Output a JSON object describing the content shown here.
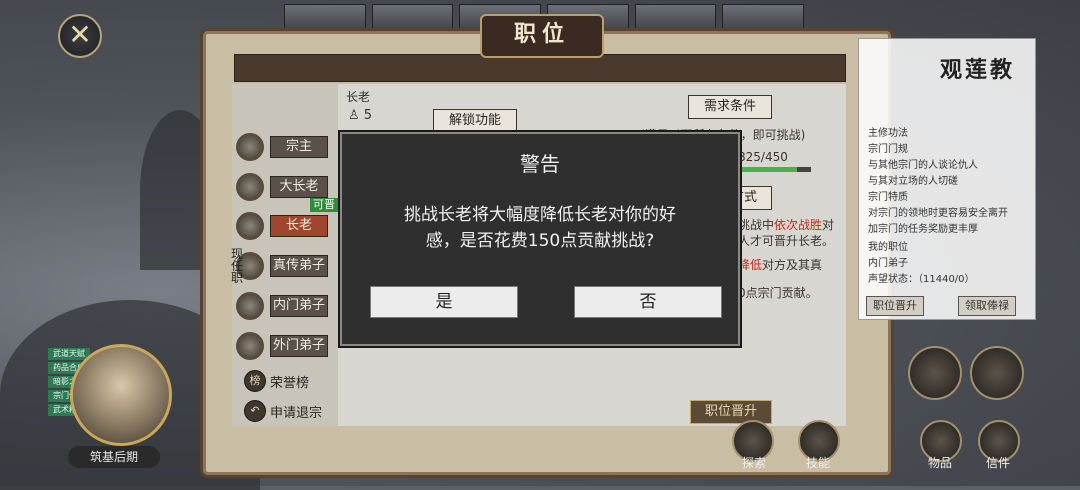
{
  "frame_title": "职位",
  "left_ranks": [
    {
      "label": "宗主",
      "active": false
    },
    {
      "label": "大长老",
      "active": false
    },
    {
      "label": "长老",
      "active": true
    },
    {
      "label": "真传弟子",
      "active": false
    },
    {
      "label": "内门弟子",
      "active": false
    },
    {
      "label": "外门弟子",
      "active": false
    }
  ],
  "current_position_tag": "现任职",
  "promotable_tag": "可晋",
  "side_buttons": [
    {
      "icon": "榜",
      "label": "荣誉榜"
    },
    {
      "icon": "↶",
      "label": "申请退宗"
    }
  ],
  "rank_header": "长老",
  "rank_count": "5",
  "unlock_button": "解锁功能",
  "requirements_button": "需求条件",
  "requirements_note": "(满足以下所有条件，即可挑战)",
  "progress_text": "825/450",
  "progress_value": 0.82,
  "method_button": "方式",
  "challenge_text_1": "挑战中",
  "challenge_text_red": "依次战胜",
  "challenge_text_2": "对",
  "challenge_text_3": "人才可晋升长老。",
  "lower_text_red": "降低",
  "lower_text_2": "对方及其真",
  "cost_text": "0点宗门贡献。",
  "promote_button": "职位晋升",
  "sect": {
    "name": "观莲教",
    "lines": [
      "主修功法",
      "宗门门规",
      "与其他宗门的人谈论仇人",
      "与其对立场的人切磋",
      "宗门特质",
      "对宗门的领地时更容易安全离开",
      "加宗门的任务奖励更丰厚",
      "我的职位",
      "内门弟子",
      "声望状态：（11440/0）"
    ],
    "buttons": [
      "职位晋升",
      "领取俸禄"
    ]
  },
  "character": {
    "name": "筑基后期",
    "tags": [
      "武道天赋",
      "药品合成",
      "暗影之力",
      "宗门传承",
      "武术精通"
    ]
  },
  "bottom_labels": [
    "探索",
    "技能",
    "物品",
    "信件"
  ],
  "dialog": {
    "title": "警告",
    "message_line1": "挑战长老将大幅度降低长老对你的好",
    "message_line2": "感，是否花费150点贡献挑战?",
    "yes_label": "是",
    "no_label": "否"
  }
}
